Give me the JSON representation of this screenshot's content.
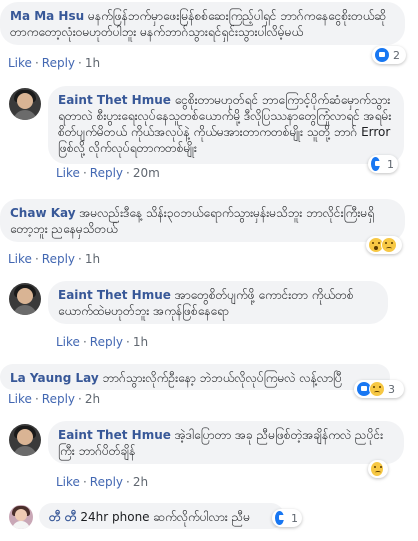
{
  "comments": [
    {
      "author": "Ma Ma Hsu",
      "text": "မနက်ဖြန်ဘက်မှာဖေးမြန်စစ်ဆေးကြည့်ပါရှင် ဘာဂ်ကနေငွေစိုးတယ်ဆိုတာကတော့လုံးဝမဟုတ်ပါဘူး မနက်ဘာဂ်သွားရင်ရှင်းသွားပါလိမ့်မယ်",
      "like": "Like",
      "reply": "Reply",
      "time": "1h",
      "reaction_count": "2"
    },
    {
      "author": "Eaint Thet Hmue",
      "text": "ငွေစိုးတာမဟုတ်ရင် ဘာကြောင့်ပိုက်ဆံမှောက်သွားရတာလဲ စီးပွားရေးလုပ်နေသူတစ်ယောက်မို့ ဒီလိုပြဿနာတွေကြုံလာရင် အရမ်းစိတ်ပျက်မိတယ် ကိုယ်အလုပ်နဲ့ ကိုယ်မအားတာကတစ်မျိုး သူတို့ ဘာဂ် Error ဖြစ်လို့ လိုက်လုပ်ရတာကတစ်မျိုး",
      "like": "Like",
      "reply": "Reply",
      "time": "20m",
      "reaction_count": "1"
    },
    {
      "author": "Chaw Kay",
      "text": "အမလည်းဒီနေ့ သိန်း၃၀ဘယ်ရောက်သွားမှန်းမသိဘူး ဘာလိုင်းကြီးမရှိတော့ဘူး ညနေမှသိတယ်",
      "like": "Like",
      "reply": "Reply",
      "time": "1h"
    },
    {
      "author": "Eaint Thet Hmue",
      "text": "အာတွေစိတ်ပျက်ဖို့ ကောင်းတာ ကိုယ်တစ်ယောက်ထဲမဟုတ်ဘူး အကုန်ဖြစ်နေရော",
      "like": "Like",
      "reply": "Reply",
      "time": "1h"
    },
    {
      "author": "La Yaung Lay",
      "text": "ဘာဂ်သွားလိုက်ဦးနော့ ဘဲဘယ်လိုလုပ်ကြမလဲ လန့်လာပြီ",
      "like": "Like",
      "reply": "Reply",
      "time": "2h",
      "reaction_count": "3"
    },
    {
      "author": "Eaint Thet Hmue",
      "text": "အဲ့ဒါပြောတာ အခု ညီမဖြစ်တဲ့အချိန်ကလဲ ညပိုင်းကြီး ဘာဂ်ပိတ်ချိန်",
      "like": "Like",
      "reply": "Reply",
      "time": "2h"
    },
    {
      "author": "တီ တီ",
      "text": "24hr phone ဆက်လိုက်ပါလား ညီမ",
      "reaction_count": "1"
    }
  ]
}
